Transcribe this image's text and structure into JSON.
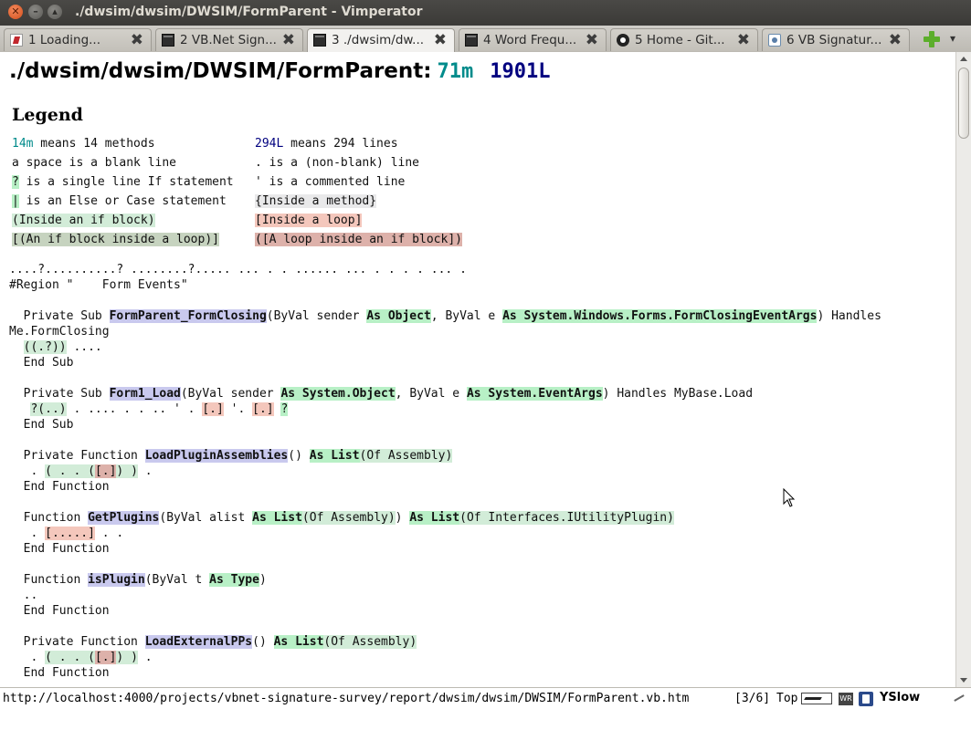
{
  "window": {
    "title": "./dwsim/dwsim/DWSIM/FormParent - Vimperator",
    "close_glyph": "✕",
    "min_glyph": "–",
    "max_glyph": "▴"
  },
  "tabs": [
    {
      "label": "1  Loading...",
      "icon": "vimperator-icon",
      "active": false
    },
    {
      "label": "2  VB.Net Sign...",
      "icon": "terminal-icon",
      "active": false
    },
    {
      "label": "3  ./dwsim/dw...",
      "icon": "terminal-icon",
      "active": true
    },
    {
      "label": "4  Word Frequ...",
      "icon": "terminal-icon",
      "active": false
    },
    {
      "label": "5  Home - Git...",
      "icon": "github-icon",
      "active": false
    },
    {
      "label": "6  VB Signatur...",
      "icon": "page-icon",
      "active": false
    }
  ],
  "tab_close_glyph": "✖",
  "tab_menu_glyph": "▾",
  "page": {
    "heading_path": "./dwsim/dwsim/DWSIM/FormParent:",
    "heading_methods": "71m",
    "heading_lines": "1901L",
    "legend_title": "Legend",
    "legend": {
      "r1c1a": "14m",
      "r1c1b": " means 14 methods",
      "r1c2a": "294L",
      "r1c2b": " means 294 lines",
      "r2c1": "a space is a blank line",
      "r2c2": ". is a (non-blank) line",
      "r3c1a": "?",
      "r3c1b": " is a single line If statement",
      "r3c2": "' is a commented line",
      "r4c1a": "|",
      "r4c1b": " is an Else or Case statement",
      "r4c2": "{Inside a method}",
      "r5c1": "(Inside an if block)",
      "r5c2": "[Inside a loop]",
      "r6c1": "[(An if block inside a loop)]",
      "r6c2": "([A loop inside an if block])"
    },
    "code": {
      "dotline": "....?..........? ........?..... ... . . ...... ... . . . . ... .",
      "region": "#Region \"    Form Events\"",
      "s1_pre": "  Private Sub ",
      "s1_name": "FormParent_FormClosing",
      "s1_a": "(ByVal sender ",
      "s1_t1": "As Object",
      "s1_b": ", ByVal e ",
      "s1_t2": "As System.Windows.Forms.FormClosingEventArgs",
      "s1_c": ") Handles",
      "s1_cont": "Me.FormClosing",
      "s1_body": "((.?))",
      "s1_body2": " ....",
      "s1_end": "  End Sub",
      "s2_pre": "  Private Sub ",
      "s2_name": "Form1_Load",
      "s2_a": "(ByVal sender ",
      "s2_t1": "As System.Object",
      "s2_b": ", ByVal e ",
      "s2_t2": "As System.EventArgs",
      "s2_c": ") Handles MyBase.Load",
      "s2_body_a": "?(..)",
      "s2_body_b": " . .... . . .. ' . ",
      "s2_body_c": "[.]",
      "s2_body_d": " '. ",
      "s2_body_e": "[.]",
      "s2_body_f": " ",
      "s2_body_g": "?",
      "s2_end": "  End Sub",
      "s3_pre": "  Private Function ",
      "s3_name": "LoadPluginAssemblies",
      "s3_a": "() ",
      "s3_t": "As List",
      "s3_t2": "(Of Assembly)",
      "s3_body_a": ". ",
      "s3_body_b": "( . . (",
      "s3_body_c": "[.]",
      "s3_body_d": ") )",
      "s3_body_e": " .",
      "s3_end": "  End Function",
      "s4_pre": "  Function ",
      "s4_name": "GetPlugins",
      "s4_a": "(ByVal alist ",
      "s4_t1": "As List",
      "s4_t1b": "(Of Assembly)",
      "s4_b": ") ",
      "s4_t2": "As List",
      "s4_t2b": "(Of Interfaces.IUtilityPlugin)",
      "s4_body_a": ". ",
      "s4_body_b": "[.....]",
      "s4_body_c": " . .",
      "s4_end": "  End Function",
      "s5_pre": "  Function ",
      "s5_name": "isPlugin",
      "s5_a": "(ByVal t ",
      "s5_t": "As Type",
      "s5_b": ")",
      "s5_body": "..",
      "s5_end": "  End Function",
      "s6_pre": "  Private Function ",
      "s6_name": "LoadExternalPPs",
      "s6_a": "() ",
      "s6_t": "As List",
      "s6_t2": "(Of Assembly)",
      "s6_body_a": ". ",
      "s6_body_b": "( . . (",
      "s6_body_c": "[.]",
      "s6_body_d": ") )",
      "s6_body_e": " .",
      "s6_end": "  End Function"
    }
  },
  "status": {
    "url": "http://localhost:4000/projects/vbnet-signature-survey/report/dwsim/dwsim/DWSIM/FormParent.vb.htm",
    "position": "[3/6]",
    "scroll": "Top",
    "wr_label": "WR",
    "yslow": "YSlow"
  },
  "colors": {
    "teal": "#008b8b",
    "navy": "#00007f",
    "if_highlight": "#b8f0c6",
    "loop_highlight": "#f4c7bc",
    "method_highlight": "#c9c9ee"
  }
}
